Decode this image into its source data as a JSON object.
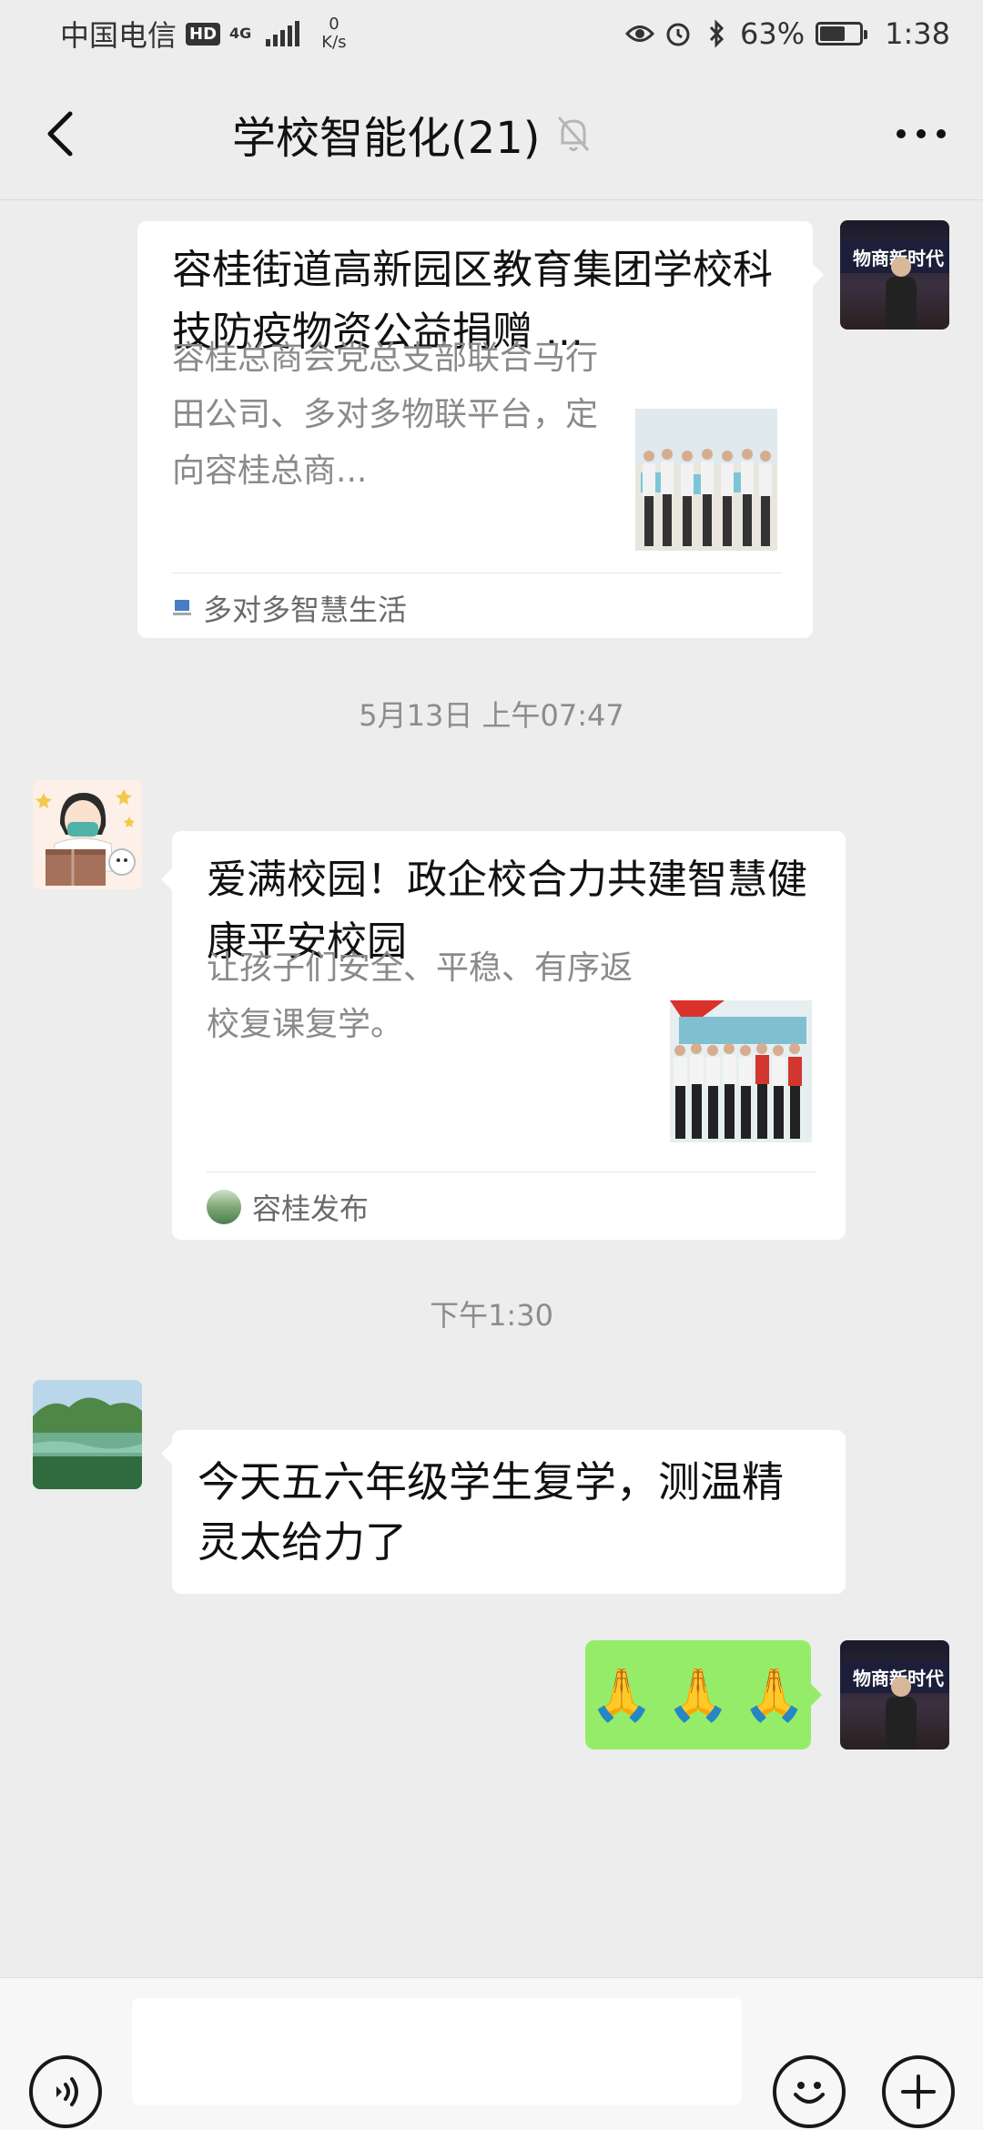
{
  "status_bar": {
    "carrier": "中国电信",
    "hd": "HD",
    "network": "4G",
    "speed_value": "0",
    "speed_unit": "K/s",
    "battery": "63%",
    "battery_level": 0.63,
    "time": "1:38"
  },
  "nav": {
    "title": "学校智能化(21)",
    "back_icon": "chevron-left-icon",
    "muted_icon": "bell-off-icon",
    "more_icon": "more-dots-icon"
  },
  "messages": [
    {
      "type": "link_card",
      "sender": "self",
      "title": "容桂街道高新园区教育集团学校科技防疫物资公益捐赠 ...",
      "desc": "容桂总商会党总支部联合马行田公司、多对多物联平台，定向容桂总商...",
      "source": "多对多智慧生活"
    },
    {
      "type": "timestamp",
      "text": "5月13日 上午07:47"
    },
    {
      "type": "link_card",
      "sender": "other",
      "title": "爱满校园！政企校合力共建智慧健康平安校园",
      "desc": "让孩子们安全、平稳、有序返校复课复学。",
      "source": "容桂发布"
    },
    {
      "type": "timestamp",
      "text": "下午1:30"
    },
    {
      "type": "text",
      "sender": "other",
      "text": "今天五六年级学生复学，测温精灵太给力了"
    },
    {
      "type": "emoji",
      "sender": "self",
      "emoji": [
        "🙏",
        "🙏",
        "🙏"
      ]
    }
  ],
  "avatar_banner": "物商新时代",
  "input_bar": {
    "placeholder": "",
    "voice_icon": "voice-icon",
    "emoji_icon": "emoji-icon",
    "plus_icon": "plus-icon"
  },
  "colors": {
    "background": "#ededed",
    "self_bubble": "#95ec69",
    "other_bubble": "#ffffff"
  }
}
